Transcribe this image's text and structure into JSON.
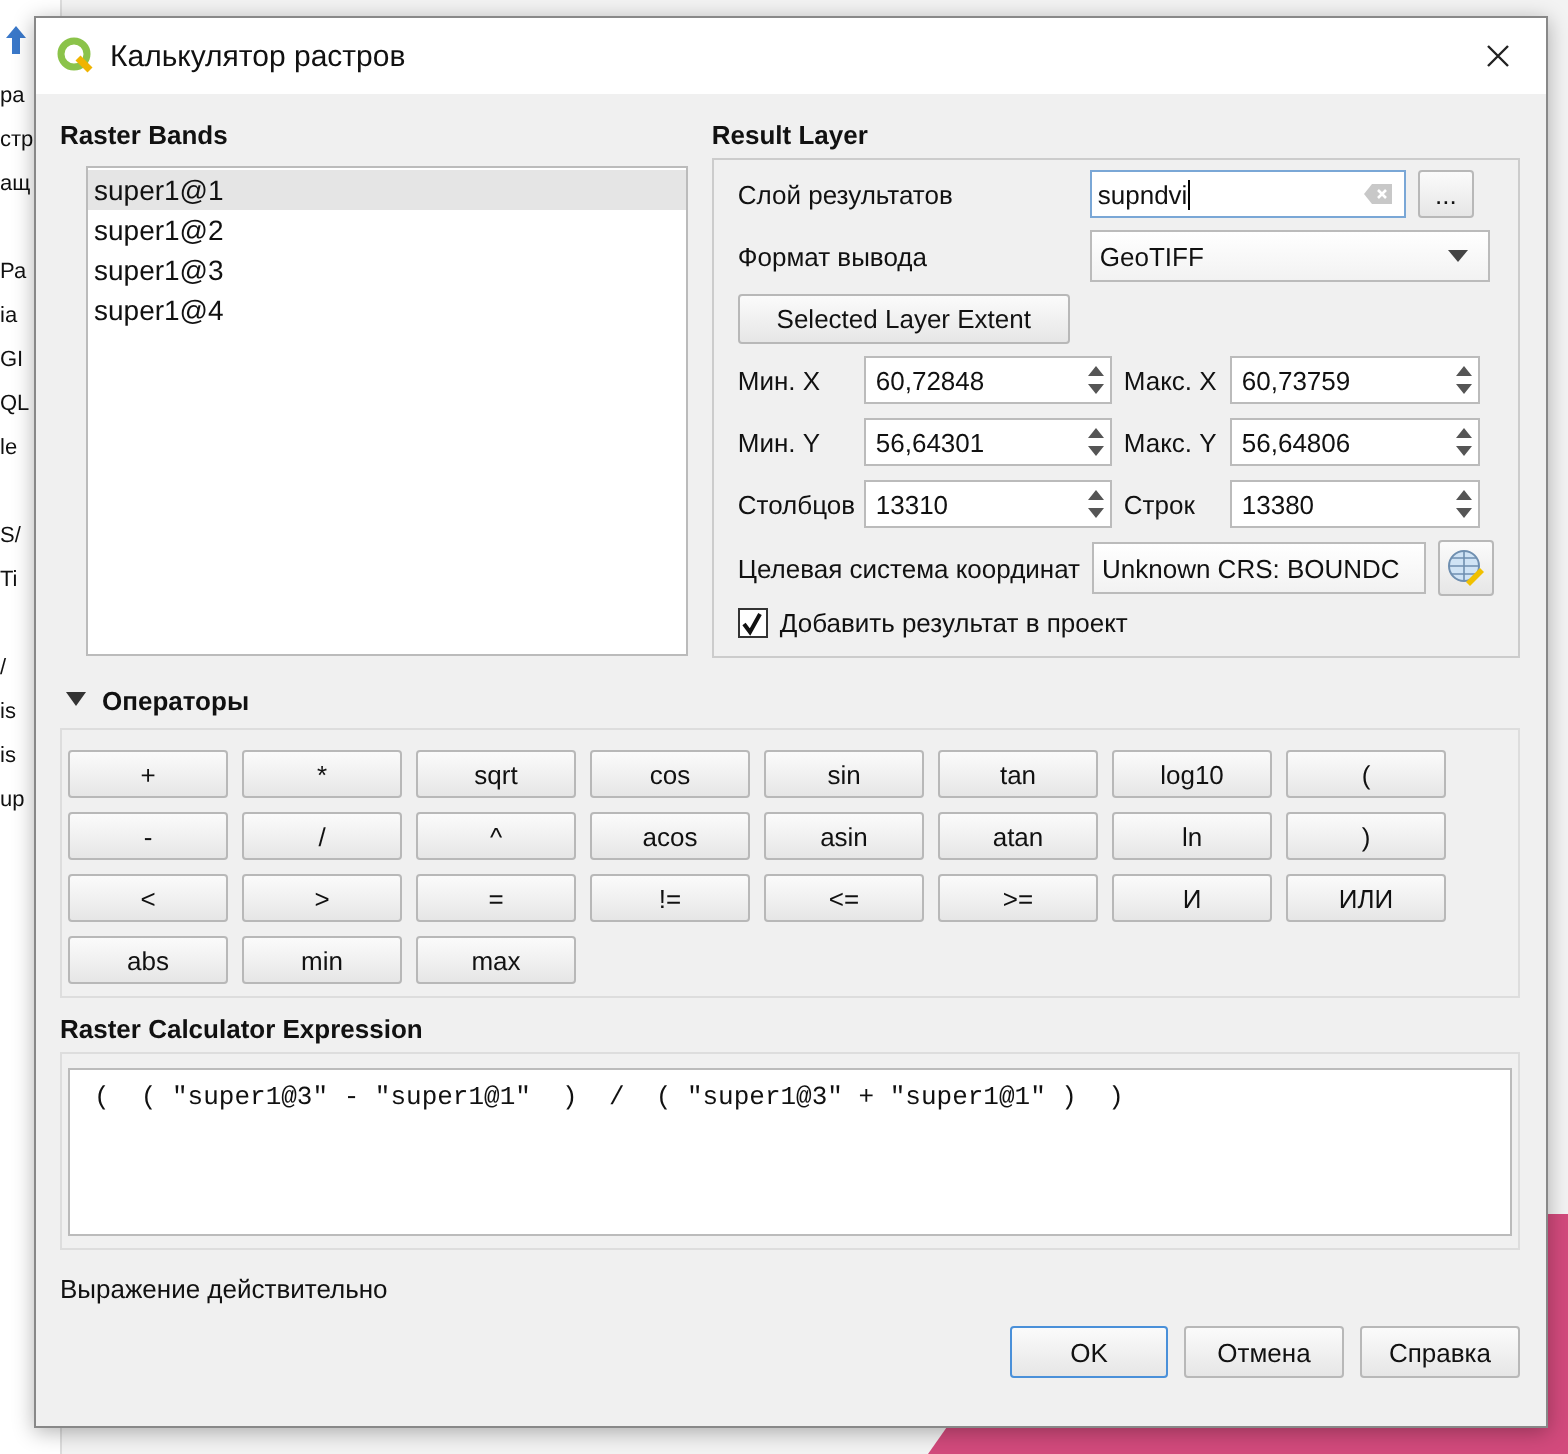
{
  "background_window": {
    "texts": [
      "ра",
      "стр",
      "ащ",
      "Ра",
      "ia",
      "GI",
      "QL",
      "le",
      "S/",
      "Ti",
      "/",
      "is",
      "is",
      "up"
    ]
  },
  "window": {
    "title": "Калькулятор растров"
  },
  "raster_bands": {
    "title": "Raster Bands",
    "items": [
      {
        "label": "super1@1",
        "selected": true
      },
      {
        "label": "super1@2",
        "selected": false
      },
      {
        "label": "super1@3",
        "selected": false
      },
      {
        "label": "super1@4",
        "selected": false
      }
    ]
  },
  "result_layer": {
    "title": "Result Layer",
    "output_layer": {
      "label": "Слой результатов",
      "value": "supndvi",
      "browse": "..."
    },
    "output_format": {
      "label": "Формат вывода",
      "value": "GeoTIFF"
    },
    "extent_button": "Selected Layer Extent",
    "fields": [
      {
        "label": "Мин. X",
        "value": "60,72848"
      },
      {
        "label": "Макс. X",
        "value": "60,73759"
      },
      {
        "label": "Мин. Y",
        "value": "56,64301"
      },
      {
        "label": "Макс. Y",
        "value": "56,64806"
      },
      {
        "label": "Столбцов",
        "value": "13310"
      },
      {
        "label": "Строк",
        "value": "13380"
      }
    ],
    "crs": {
      "label": "Целевая система координат",
      "value": "Unknown CRS: BOUNDC"
    },
    "add_to_project": {
      "label": "Добавить результат в проект",
      "checked": true
    }
  },
  "operators": {
    "title": "Операторы",
    "expanded": true,
    "buttons": [
      "+",
      "*",
      "sqrt",
      "cos",
      "sin",
      "tan",
      "log10",
      "(",
      "-",
      "/",
      "^",
      "acos",
      "asin",
      "atan",
      "ln",
      ")",
      "<",
      ">",
      "=",
      "!=",
      "<=",
      ">=",
      "И",
      "ИЛИ",
      "abs",
      "min",
      "max"
    ]
  },
  "expression": {
    "title": "Raster Calculator Expression",
    "value": "(  ( \"super1@3\" - \"super1@1\"  )  /  ( \"super1@3\" + \"super1@1\" )  )"
  },
  "status": "Выражение действительно",
  "buttons": [
    {
      "label": "OK",
      "default": true
    },
    {
      "label": "Отмена",
      "default": false
    },
    {
      "label": "Справка",
      "default": false
    }
  ]
}
